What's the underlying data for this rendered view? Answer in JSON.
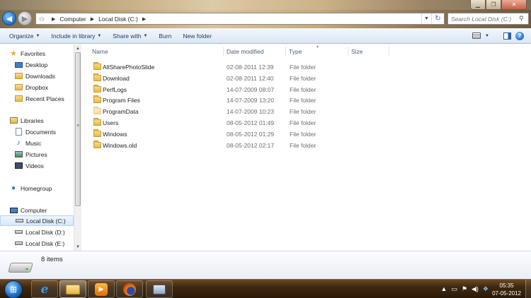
{
  "address": {
    "segments": [
      "Computer",
      "Local Disk (C:)"
    ]
  },
  "search": {
    "placeholder": "Search Local Disk (C:)"
  },
  "toolbar": {
    "organize": "Organize",
    "include_in_library": "Include in library",
    "share_with": "Share with",
    "burn": "Burn",
    "new_folder": "New folder"
  },
  "nav": {
    "favorites": "Favorites",
    "desktop": "Desktop",
    "downloads": "Downloads",
    "dropbox": "Dropbox",
    "recent_places": "Recent Places",
    "libraries": "Libraries",
    "documents": "Documents",
    "music": "Music",
    "pictures": "Pictures",
    "videos": "Videos",
    "homegroup": "Homegroup",
    "computer": "Computer",
    "disk_c": "Local Disk (C:)",
    "disk_d": "Local Disk (D:)",
    "disk_e": "Local Disk (E:)"
  },
  "columns": {
    "name": "Name",
    "date_modified": "Date modified",
    "type": "Type",
    "size": "Size"
  },
  "files": [
    {
      "name": "AllSharePhotoSlide",
      "date": "02-08-2011 12:39",
      "type": "File folder"
    },
    {
      "name": "Download",
      "date": "02-08-2011 12:40",
      "type": "File folder"
    },
    {
      "name": "PerfLogs",
      "date": "14-07-2009 08:07",
      "type": "File folder"
    },
    {
      "name": "Program Files",
      "date": "14-07-2009 13:20",
      "type": "File folder"
    },
    {
      "name": "ProgramData",
      "date": "14-07-2009 10:23",
      "type": "File folder"
    },
    {
      "name": "Users",
      "date": "08-05-2012 01:49",
      "type": "File folder"
    },
    {
      "name": "Windows",
      "date": "08-05-2012 01:29",
      "type": "File folder"
    },
    {
      "name": "Windows.old",
      "date": "08-05-2012 02:17",
      "type": "File folder"
    }
  ],
  "status": {
    "item_count": "8 items"
  },
  "clock": {
    "time": "05:35",
    "date": "07-05-2012"
  }
}
